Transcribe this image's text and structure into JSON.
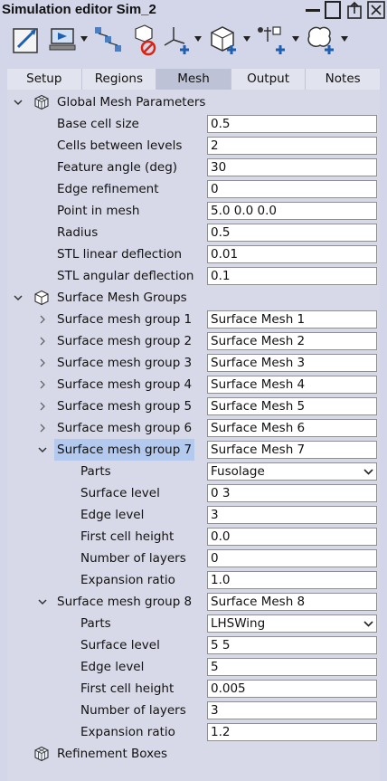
{
  "window": {
    "title": "Simulation editor Sim_2"
  },
  "tabs": [
    {
      "label": "Setup"
    },
    {
      "label": "Regions"
    },
    {
      "label": "Mesh",
      "active": true
    },
    {
      "label": "Output"
    },
    {
      "label": "Notes"
    }
  ],
  "global": {
    "label": "Global Mesh Parameters",
    "fields": [
      {
        "label": "Base cell size",
        "value": "0.5"
      },
      {
        "label": "Cells between levels",
        "value": "2"
      },
      {
        "label": "Feature angle (deg)",
        "value": "30"
      },
      {
        "label": "Edge refinement",
        "value": "0"
      },
      {
        "label": "Point in mesh",
        "value": "5.0 0.0 0.0"
      },
      {
        "label": "Radius",
        "value": "0.5"
      },
      {
        "label": "STL linear deflection",
        "value": "0.01"
      },
      {
        "label": "STL angular deflection",
        "value": "0.1"
      }
    ]
  },
  "surface": {
    "label": "Surface Mesh Groups",
    "groups": [
      {
        "label": "Surface mesh group 1",
        "value": "Surface Mesh 1"
      },
      {
        "label": "Surface mesh group 2",
        "value": "Surface Mesh 2"
      },
      {
        "label": "Surface mesh group 3",
        "value": "Surface Mesh 3"
      },
      {
        "label": "Surface mesh group 4",
        "value": "Surface Mesh 4"
      },
      {
        "label": "Surface mesh group 5",
        "value": "Surface Mesh 5"
      },
      {
        "label": "Surface mesh group 6",
        "value": "Surface Mesh 6"
      },
      {
        "label": "Surface mesh group 7",
        "value": "Surface Mesh 7",
        "selected": true,
        "params": [
          {
            "label": "Parts",
            "value": "Fusolage"
          },
          {
            "label": "Surface level",
            "value": "0 3"
          },
          {
            "label": "Edge level",
            "value": "3"
          },
          {
            "label": "First cell height",
            "value": "0.0"
          },
          {
            "label": "Number of layers",
            "value": "0"
          },
          {
            "label": "Expansion ratio",
            "value": "1.0"
          }
        ]
      },
      {
        "label": "Surface mesh group 8",
        "value": "Surface Mesh 8",
        "params": [
          {
            "label": "Parts",
            "value": "LHSWing"
          },
          {
            "label": "Surface level",
            "value": "5 5"
          },
          {
            "label": "Edge level",
            "value": "5"
          },
          {
            "label": "First cell height",
            "value": "0.005"
          },
          {
            "label": "Number of layers",
            "value": "3"
          },
          {
            "label": "Expansion ratio",
            "value": "1.2"
          }
        ]
      }
    ]
  },
  "refinement": {
    "label": "Refinement Boxes"
  },
  "colors": {
    "selection": "#b3c9ee",
    "panel": "#d3d6e8",
    "tree": "#d7d9e9"
  }
}
